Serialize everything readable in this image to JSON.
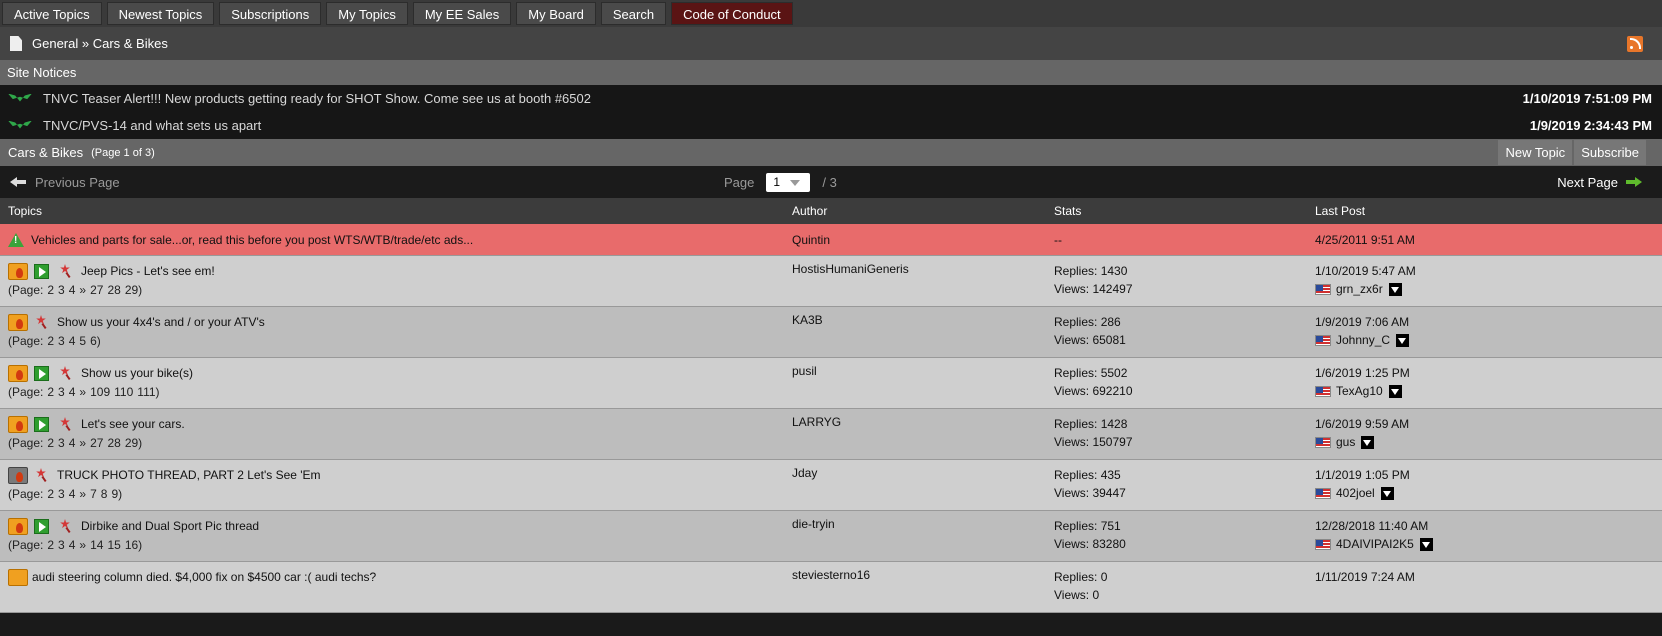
{
  "nav": {
    "items": [
      "Active Topics",
      "Newest Topics",
      "Subscriptions",
      "My Topics",
      "My EE Sales",
      "My Board",
      "Search",
      "Code of Conduct"
    ]
  },
  "breadcrumb": {
    "text": "General » Cars & Bikes"
  },
  "notices": {
    "heading": "Site Notices",
    "items": [
      {
        "title": "TNVC Teaser Alert!!! New products getting ready for SHOT Show. Come see us at booth #6502",
        "date": "1/10/2019 7:51:09 PM"
      },
      {
        "title": "TNVC/PVS-14 and what sets us apart",
        "date": "1/9/2019 2:34:43 PM"
      }
    ]
  },
  "forum": {
    "name": "Cars & Bikes",
    "page_info": "(Page 1 of 3)",
    "new_topic": "New Topic",
    "subscribe": "Subscribe"
  },
  "pager": {
    "prev": "Previous Page",
    "page_label": "Page",
    "current": "1",
    "total": "/ 3",
    "next": "Next Page"
  },
  "table": {
    "headers": {
      "topics": "Topics",
      "author": "Author",
      "stats": "Stats",
      "last_post": "Last Post"
    },
    "sticky": {
      "title": "Vehicles and parts for sale...or, read this before you post WTS/WTB/trade/etc ads...",
      "author": "Quintin",
      "stats": "--",
      "last_date": "4/25/2011 9:51 AM"
    },
    "rows": [
      {
        "title": "Jeep Pics - Let's see em!",
        "pages_prefix": "(Page:",
        "pages": [
          "2",
          "3",
          "4",
          "»",
          "27",
          "28",
          "29)"
        ],
        "author": "HostisHumaniGeneris",
        "replies": "Replies: 1430",
        "views": "Views: 142497",
        "last_date": "1/10/2019 5:47 AM",
        "last_user": "grn_zx6r"
      },
      {
        "title": "Show us your 4x4's and / or your ATV's",
        "pages_prefix": "(Page:",
        "pages": [
          "2",
          "3",
          "4",
          "5",
          "6)"
        ],
        "author": "KA3B",
        "replies": "Replies: 286",
        "views": "Views: 65081",
        "last_date": "1/9/2019 7:06 AM",
        "last_user": "Johnny_C"
      },
      {
        "title": "Show us your bike(s)",
        "pages_prefix": "(Page:",
        "pages": [
          "2",
          "3",
          "4",
          "»",
          "109",
          "110",
          "111)"
        ],
        "author": "pusil",
        "replies": "Replies: 5502",
        "views": "Views: 692210",
        "last_date": "1/6/2019 1:25 PM",
        "last_user": "TexAg10"
      },
      {
        "title": "Let's see your cars.",
        "pages_prefix": "(Page:",
        "pages": [
          "2",
          "3",
          "4",
          "»",
          "27",
          "28",
          "29)"
        ],
        "author": "LARRYG",
        "replies": "Replies: 1428",
        "views": "Views: 150797",
        "last_date": "1/6/2019 9:59 AM",
        "last_user": "gus"
      },
      {
        "title": "TRUCK PHOTO THREAD, PART 2 Let's See 'Em",
        "pages_prefix": "(Page:",
        "pages": [
          "2",
          "3",
          "4",
          "»",
          "7",
          "8",
          "9)"
        ],
        "author": "Jday",
        "replies": "Replies: 435",
        "views": "Views: 39447",
        "last_date": "1/1/2019 1:05 PM",
        "last_user": "402joel"
      },
      {
        "title": "Dirbike and Dual Sport Pic thread",
        "pages_prefix": "(Page:",
        "pages": [
          "2",
          "3",
          "4",
          "»",
          "14",
          "15",
          "16)"
        ],
        "author": "die-tryin",
        "replies": "Replies: 751",
        "views": "Views: 83280",
        "last_date": "12/28/2018 11:40 AM",
        "last_user": "4DAIVIPAI2K5"
      },
      {
        "title": "audi steering column died. $4,000 fix on $4500 car :( audi techs?",
        "author": "steviesterno16",
        "replies": "Replies: 0",
        "views": "Views: 0",
        "last_date": "1/11/2019 7:24 AM"
      }
    ]
  }
}
